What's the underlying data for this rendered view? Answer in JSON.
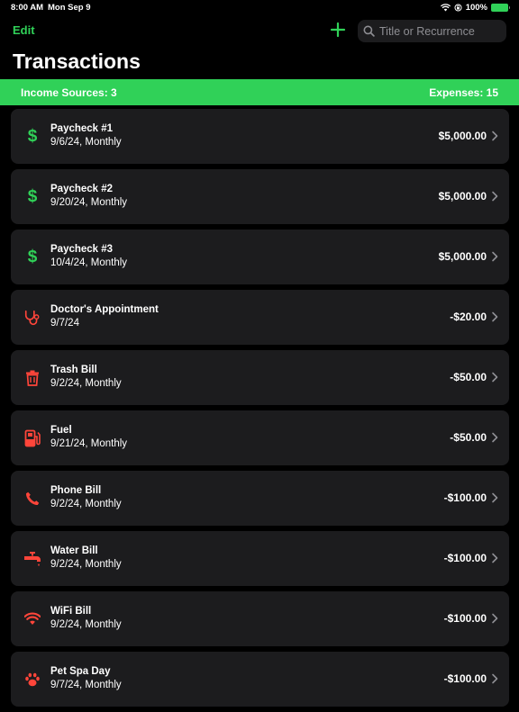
{
  "status_bar": {
    "time": "8:00 AM",
    "date": "Mon Sep 9",
    "battery": "100%"
  },
  "nav": {
    "edit_label": "Edit",
    "add_icon": "plus-icon",
    "search_placeholder": "Title or Recurrence",
    "search_value": ""
  },
  "page_title": "Transactions",
  "summary": {
    "income_label": "Income Sources: 3",
    "expenses_label": "Expenses: 15"
  },
  "colors": {
    "accent": "#30d158",
    "expense_icon": "#ff453a",
    "row_bg": "#1c1c1e"
  },
  "transactions": [
    {
      "title": "Paycheck #1",
      "subtitle": "9/6/24, Monthly",
      "amount": "$5,000.00",
      "icon": "dollar-icon",
      "type": "income"
    },
    {
      "title": "Paycheck #2",
      "subtitle": "9/20/24, Monthly",
      "amount": "$5,000.00",
      "icon": "dollar-icon",
      "type": "income"
    },
    {
      "title": "Paycheck #3",
      "subtitle": "10/4/24, Monthly",
      "amount": "$5,000.00",
      "icon": "dollar-icon",
      "type": "income"
    },
    {
      "title": "Doctor's Appointment",
      "subtitle": "9/7/24",
      "amount": "-$20.00",
      "icon": "stethoscope-icon",
      "type": "expense"
    },
    {
      "title": "Trash Bill",
      "subtitle": "9/2/24, Monthly",
      "amount": "-$50.00",
      "icon": "trash-icon",
      "type": "expense"
    },
    {
      "title": "Fuel",
      "subtitle": "9/21/24, Monthly",
      "amount": "-$50.00",
      "icon": "fuel-pump-icon",
      "type": "expense"
    },
    {
      "title": "Phone Bill",
      "subtitle": "9/2/24, Monthly",
      "amount": "-$100.00",
      "icon": "phone-icon",
      "type": "expense"
    },
    {
      "title": "Water Bill",
      "subtitle": "9/2/24, Monthly",
      "amount": "-$100.00",
      "icon": "faucet-icon",
      "type": "expense"
    },
    {
      "title": "WiFi Bill",
      "subtitle": "9/2/24, Monthly",
      "amount": "-$100.00",
      "icon": "wifi-icon",
      "type": "expense"
    },
    {
      "title": "Pet Spa Day",
      "subtitle": "9/7/24, Monthly",
      "amount": "-$100.00",
      "icon": "paw-icon",
      "type": "expense"
    }
  ]
}
